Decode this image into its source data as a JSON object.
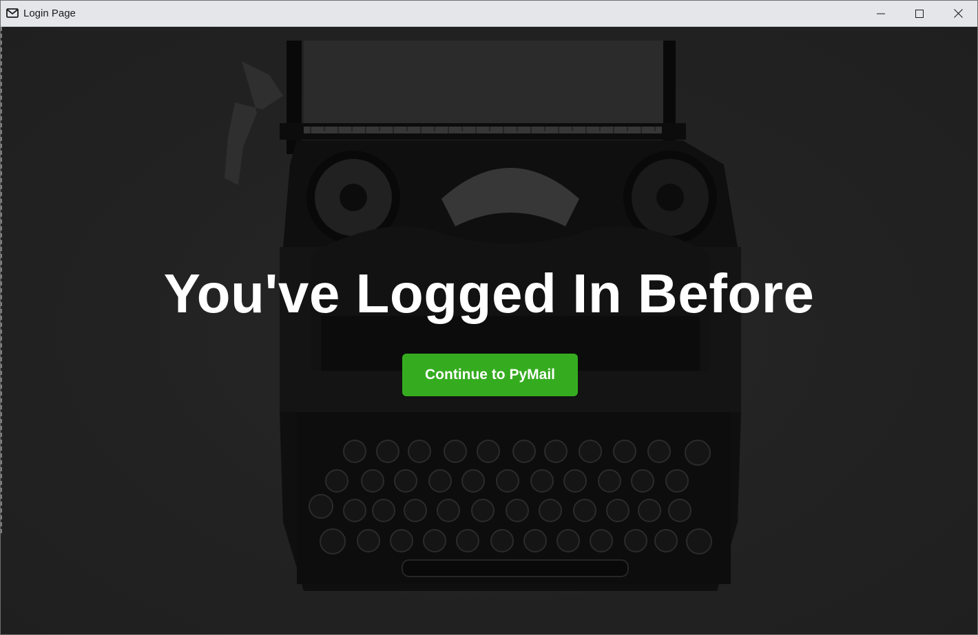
{
  "window": {
    "title": "Login Page",
    "icon": "mail-icon",
    "controls": {
      "minimize": "minimize-icon",
      "maximize": "maximize-icon",
      "close": "close-icon"
    }
  },
  "main": {
    "heading": "You've Logged In Before",
    "continue_button": "Continue to PyMail",
    "background": "typewriter-photo"
  },
  "colors": {
    "button_bg": "#35ac1f",
    "heading_text": "#ffffff",
    "titlebar_bg": "#e4e6ea",
    "overlay_bg": "#303030"
  }
}
